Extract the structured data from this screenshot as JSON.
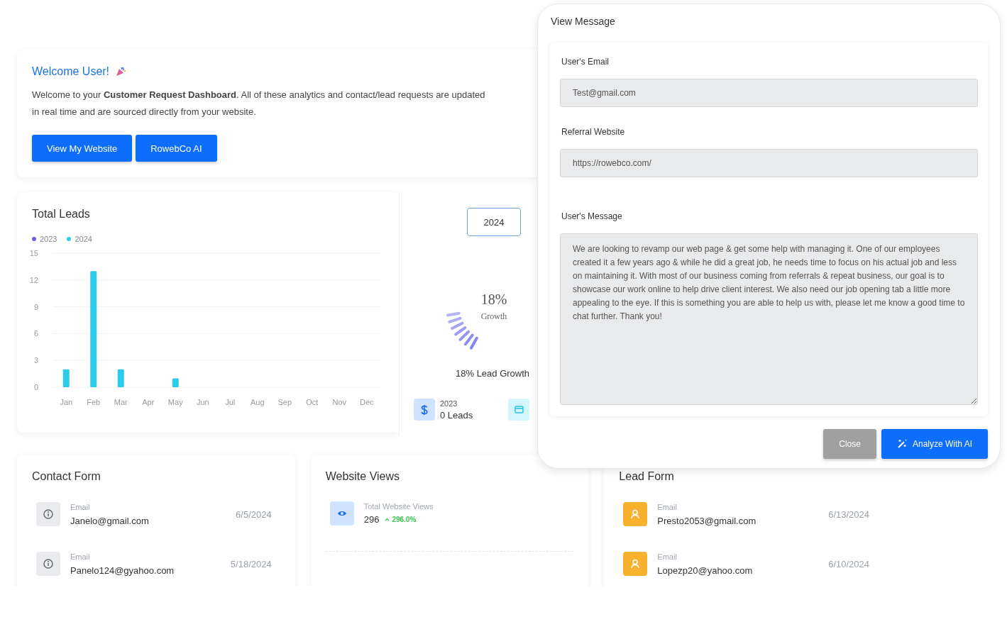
{
  "welcome": {
    "title": "Welcome User!",
    "text": "Welcome to your **Customer Request Dashboard**. All of these analytics and contact/lead requests are updated in real time and are sourced directly from your website.",
    "buttons": [
      "View My Website",
      "RowebCo AI"
    ]
  },
  "total_leads": {
    "title": "Total Leads",
    "chart_data": {
      "type": "bar",
      "categories": [
        "Jan",
        "Feb",
        "Mar",
        "Apr",
        "May",
        "Jun",
        "Jul",
        "Aug",
        "Sep",
        "Oct",
        "Nov",
        "Dec"
      ],
      "series": [
        {
          "name": "2023",
          "color": "#6c5ff5",
          "values": [
            0,
            0,
            0,
            0,
            0,
            0,
            0,
            0,
            0,
            0,
            0,
            0
          ]
        },
        {
          "name": "2024",
          "color": "#2ccbec",
          "values": [
            2,
            13,
            2,
            0,
            1,
            0,
            0,
            0,
            0,
            0,
            0,
            0
          ]
        }
      ],
      "ylim": [
        0,
        15
      ],
      "yticks": [
        0,
        3,
        6,
        9,
        12,
        15
      ],
      "grid": true
    }
  },
  "growth": {
    "year_select": "2024",
    "gauge": {
      "value": "18%",
      "label": "Growth"
    },
    "caption": "18% Lead Growth",
    "stats": [
      {
        "kind": "dollar",
        "year": "2023",
        "value": "0 Leads"
      },
      {
        "kind": "wallet"
      }
    ]
  },
  "contact_form": {
    "title": "Contact Form",
    "items": [
      {
        "label": "Email",
        "value": "Janelo@gmail.com",
        "date": "6/5/2024"
      },
      {
        "label": "Email",
        "value": "Panelo124@gyahoo.com",
        "date": "5/18/2024"
      }
    ]
  },
  "website_views": {
    "title": "Website Views",
    "label": "Total Website Views",
    "value": "296",
    "change": "296.0%"
  },
  "lead_form": {
    "title": "Lead Form",
    "items": [
      {
        "label": "Email",
        "value": "Presto2053@gmail.com",
        "date": "6/13/2024"
      },
      {
        "label": "Email",
        "value": "Lopezp20@yahoo.com",
        "date": "6/10/2024"
      }
    ]
  },
  "modal": {
    "title": "View Message",
    "fields": [
      {
        "kind": "input",
        "label": "User's Email",
        "value": "Test@gmail.com"
      },
      {
        "kind": "input",
        "label": "Referral Website",
        "value": "https://rowebco.com/"
      },
      {
        "kind": "textarea",
        "label": "User's Message",
        "value": "We are looking to revamp our web page & get some help with managing it. One of our employees created it a few years ago & while he did a great job, he needs time to focus on his actual job and less on maintaining it. With most of our business coming from referrals & repeat business, our goal is to showcase our work online to help drive client interest. We also need our job opening tab a little more appealing to the eye. If this is something you are able to help us with, please let me know a good time to chat further. Thank you!"
      }
    ],
    "buttons": [
      {
        "kind": "secondary",
        "label": "Close"
      },
      {
        "kind": "primary",
        "label": "Analyze With AI"
      }
    ]
  }
}
